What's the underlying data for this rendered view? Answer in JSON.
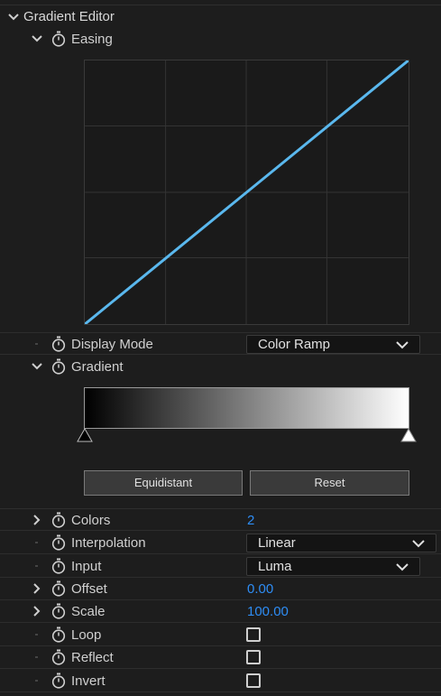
{
  "panel": {
    "title": "Gradient Editor"
  },
  "easing": {
    "label": "Easing"
  },
  "display_mode": {
    "label": "Display Mode",
    "value": "Color Ramp"
  },
  "gradient": {
    "label": "Gradient"
  },
  "buttons": {
    "equidistant": "Equidistant",
    "reset": "Reset"
  },
  "properties": {
    "colors": {
      "label": "Colors",
      "value": "2"
    },
    "interpolation": {
      "label": "Interpolation",
      "value": "Linear"
    },
    "input": {
      "label": "Input",
      "value": "Luma"
    },
    "offset": {
      "label": "Offset",
      "value": "0.00"
    },
    "scale": {
      "label": "Scale",
      "value": "100.00"
    },
    "loop": {
      "label": "Loop",
      "checked": false
    },
    "reflect": {
      "label": "Reflect",
      "checked": false
    },
    "invert": {
      "label": "Invert",
      "checked": false
    }
  },
  "colors": {
    "accent_value": "#2e8df5",
    "curve": "#5ab8ee",
    "gradient_start": "#000000",
    "gradient_end": "#ffffff"
  },
  "chart_data": {
    "type": "line",
    "x": [
      0,
      1
    ],
    "series": [
      {
        "values": [
          0,
          1
        ]
      }
    ],
    "xlim": [
      0,
      1
    ],
    "ylim": [
      0,
      1
    ],
    "grid": true
  }
}
